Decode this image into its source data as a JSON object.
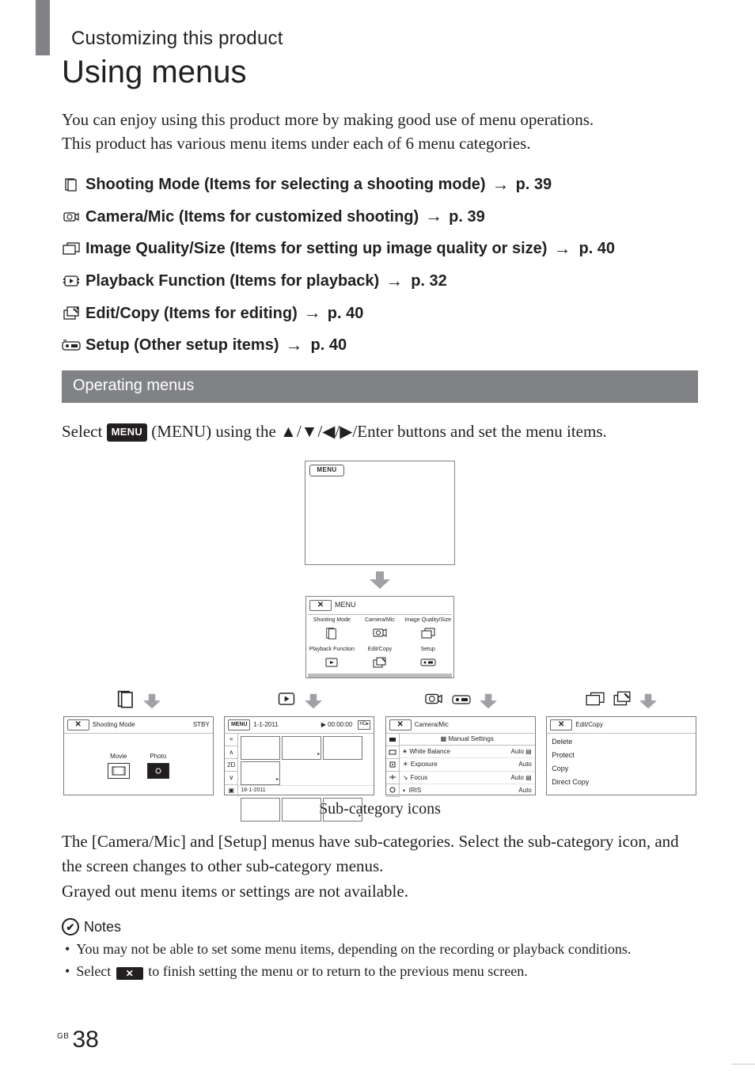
{
  "chapter": "Customizing this product",
  "title": "Using menus",
  "intro_line1": "You can enjoy using this product more by making good use of menu operations.",
  "intro_line2": "This product has various menu items under each of 6 menu categories.",
  "categories": [
    {
      "icon": "shooting-mode",
      "label": "Shooting Mode (Items for selecting a shooting mode)",
      "page": "p. 39"
    },
    {
      "icon": "camera-mic",
      "label": "Camera/Mic (Items for customized shooting)",
      "page": "p. 39"
    },
    {
      "icon": "image-quality",
      "label": "Image Quality/Size (Items for setting up image quality or size)",
      "page": "p. 40"
    },
    {
      "icon": "playback-function",
      "label": "Playback Function (Items for playback)",
      "page": "p. 32"
    },
    {
      "icon": "edit-copy",
      "label": "Edit/Copy (Items for editing)",
      "page": "p. 40"
    },
    {
      "icon": "setup",
      "label": "Setup (Other setup items)",
      "page": "p. 40"
    }
  ],
  "section_title": "Operating menus",
  "operate_pre": "Select ",
  "menu_btn": "MENU",
  "operate_mid": " (MENU) using the ",
  "operate_buttons": "▲/▼/◀/▶/Enter buttons and set the menu items.",
  "menugrid": {
    "close": "✕",
    "toplabel": "MENU",
    "cells": [
      "Shooting Mode",
      "Camera/Mic",
      "Image Quality/Size",
      "Playback Function",
      "Edit/Copy",
      "Setup"
    ]
  },
  "panels": {
    "shooting": {
      "close": "✕",
      "title": "Shooting Mode",
      "status": "STBY",
      "movie": "Movie",
      "photo": "Photo"
    },
    "playback": {
      "menu": "MENU",
      "date1": "1-1-2011",
      "tc": "▶ 00:00:00",
      "date2": "18-1-2011",
      "sidebtns": [
        "«",
        "∧",
        "2D",
        "∨",
        "▣"
      ]
    },
    "camera": {
      "close": "✕",
      "title": "Camera/Mic",
      "hdr": "▦ Manual Settings",
      "rows": [
        {
          "ic": "🞻",
          "name": "White Balance",
          "val": "Auto ▤"
        },
        {
          "ic": "☀",
          "name": "Exposure",
          "val": "Auto"
        },
        {
          "ic": "↘",
          "name": "Focus",
          "val": "Auto ▤"
        },
        {
          "ic": "◐",
          "name": "IRIS",
          "val": "Auto"
        }
      ]
    },
    "edit": {
      "close": "✕",
      "title": "Edit/Copy",
      "rows": [
        "Delete",
        "Protect",
        "Copy",
        "Direct Copy"
      ]
    }
  },
  "caption": "Sub-category icons",
  "para1": "The [Camera/Mic] and [Setup] menus have sub-categories. Select the sub-category icon, and the screen changes to other sub-category menus.",
  "para2": "Grayed out menu items or settings are not available.",
  "notes_hdr": "Notes",
  "notes_icon": "✔",
  "notes": {
    "n1": "You may not be able to set some menu items, depending on the recording or playback conditions.",
    "n2_pre": "Select ",
    "n2_x": "✕",
    "n2_post": " to finish setting the menu or to return to the previous menu screen."
  },
  "page_gb": "GB",
  "page_num": "38"
}
